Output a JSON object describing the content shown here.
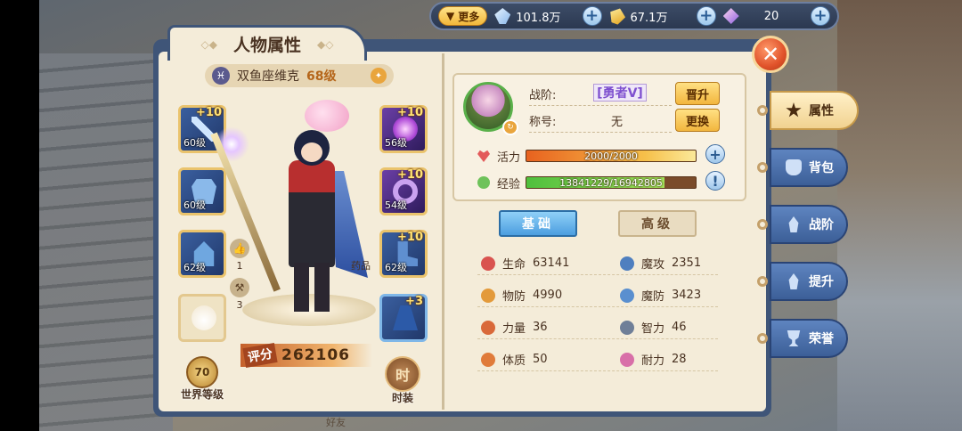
{
  "top_bar": {
    "more_label": "更多",
    "resources": [
      {
        "icon": "blue-diamond-icon",
        "value": "101.8万"
      },
      {
        "icon": "gold-ingot-icon",
        "value": "67.1万"
      },
      {
        "icon": "purple-crystal-icon",
        "value": "20"
      }
    ]
  },
  "panel": {
    "title": "人物属性",
    "close_icon": "close-icon"
  },
  "character": {
    "name": "双鱼座维克",
    "level": "68级",
    "score_tag": "评分",
    "score": "262106",
    "likes": "1",
    "hammers": "3",
    "potion_label": "药品",
    "world_level_value": "70",
    "world_level_label": "世界等级",
    "fashion_icon": "时",
    "fashion_label": "时装",
    "footer_label": "好友"
  },
  "equipment": [
    {
      "slot": "weapon",
      "plus": "+10",
      "level": "60级"
    },
    {
      "slot": "chest",
      "plus": "",
      "level": "60级"
    },
    {
      "slot": "helm",
      "plus": "",
      "level": "62级"
    },
    {
      "slot": "pet",
      "plus": "",
      "level": ""
    },
    {
      "slot": "orb",
      "plus": "+10",
      "level": "56级"
    },
    {
      "slot": "ring",
      "plus": "+10",
      "level": "54级"
    },
    {
      "slot": "boots",
      "plus": "+10",
      "level": "62级"
    },
    {
      "slot": "cape",
      "plus": "+3",
      "level": ""
    }
  ],
  "profile": {
    "rank_label": "战阶:",
    "rank_value": "[勇者V]",
    "promote_button": "晋升",
    "title_label": "称号:",
    "title_value": "无",
    "change_button": "更换",
    "vitality_label": "活力",
    "vitality_text": "2000/2000",
    "vitality_ratio": 1.0,
    "exp_label": "经验",
    "exp_text": "13841229/16942805",
    "exp_ratio": 0.817
  },
  "tabs": {
    "basic": "基础",
    "advanced": "高级"
  },
  "stats": [
    {
      "label": "生命",
      "value": "63141",
      "color": "#d9534f"
    },
    {
      "label": "魔攻",
      "value": "2351",
      "color": "#4f7fbf"
    },
    {
      "label": "物防",
      "value": "4990",
      "color": "#e39a3a"
    },
    {
      "label": "魔防",
      "value": "3423",
      "color": "#5a8fcf"
    },
    {
      "label": "力量",
      "value": "36",
      "color": "#d9693a"
    },
    {
      "label": "智力",
      "value": "46",
      "color": "#6f7f98"
    },
    {
      "label": "体质",
      "value": "50",
      "color": "#e07b3a"
    },
    {
      "label": "耐力",
      "value": "28",
      "color": "#d86fa8"
    }
  ],
  "side_tabs": [
    {
      "label": "属性",
      "icon": "star-icon",
      "active": true
    },
    {
      "label": "背包",
      "icon": "bag-icon",
      "active": false
    },
    {
      "label": "战阶",
      "icon": "flame-icon",
      "active": false
    },
    {
      "label": "提升",
      "icon": "flame-icon",
      "active": false
    },
    {
      "label": "荣誉",
      "icon": "trophy-icon",
      "active": false
    }
  ],
  "colors": {
    "panel_border": "#3f5578",
    "parchment": "#f4ecd9",
    "accent_gold": "#f2b63e",
    "tab_active": "#4c9ee0"
  }
}
